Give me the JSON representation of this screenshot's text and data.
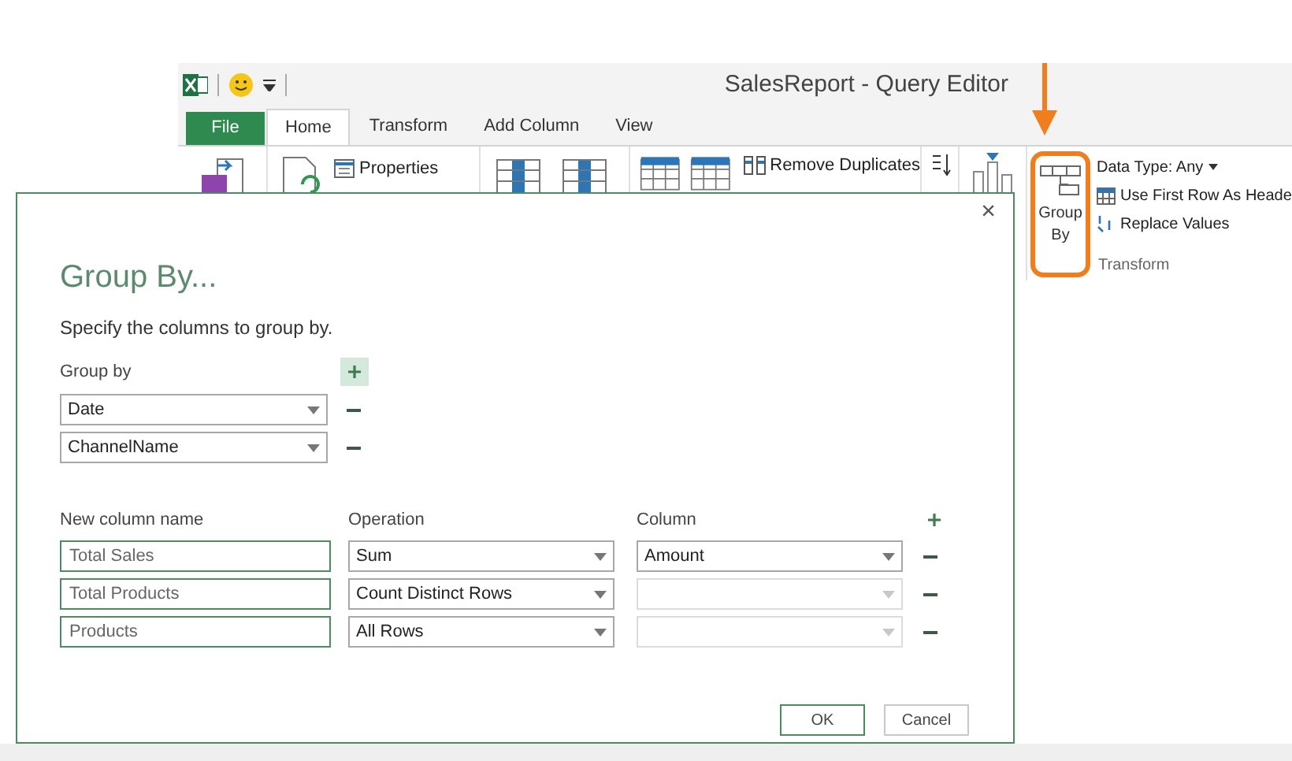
{
  "window": {
    "title": "SalesReport - Query Editor"
  },
  "tabs": [
    {
      "label": "File",
      "kind": "file",
      "selected": false
    },
    {
      "label": "Home",
      "kind": "tab",
      "selected": true
    },
    {
      "label": "Transform",
      "kind": "tab",
      "selected": false
    },
    {
      "label": "Add Column",
      "kind": "tab",
      "selected": false
    },
    {
      "label": "View",
      "kind": "tab",
      "selected": false
    }
  ],
  "ribbon": {
    "properties": "Properties",
    "remove_duplicates": "Remove Duplicates",
    "group_by": {
      "lines": [
        "Group",
        "By"
      ],
      "highlighted": true
    },
    "data_type": "Data Type: Any",
    "use_first_row": "Use First Row As Heade",
    "replace_values": "Replace Values",
    "group_label": "Transform"
  },
  "dialog": {
    "close": "×",
    "title": "Group By...",
    "subtitle": "Specify the columns to group by.",
    "group_by_label": "Group by",
    "group_by_rows": [
      {
        "value": "Date"
      },
      {
        "value": "ChannelName"
      }
    ],
    "headers": [
      "New column name",
      "Operation",
      "Column"
    ],
    "aggregations": [
      {
        "name": "Total Sales",
        "operation": "Sum",
        "column": "Amount",
        "column_disabled": false
      },
      {
        "name": "Total Products",
        "operation": "Count Distinct Rows",
        "column_disabled": true
      },
      {
        "name": "Products",
        "operation": "All Rows",
        "column_disabled": true
      }
    ],
    "buttons": [
      {
        "label": "OK",
        "kind": "primary"
      },
      {
        "label": "Cancel",
        "kind": "secondary"
      }
    ]
  }
}
